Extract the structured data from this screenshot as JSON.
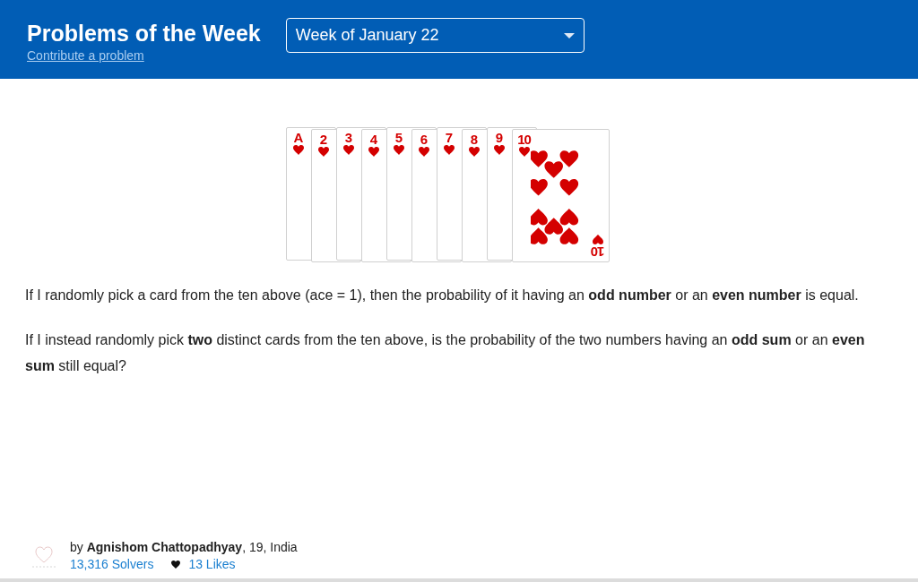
{
  "header": {
    "title": "Problems of the Week",
    "link": "Contribute a problem",
    "week_select": {
      "value": "Week of January 22"
    }
  },
  "cards": [
    {
      "rank": "A",
      "kind": "covered"
    },
    {
      "rank": "2",
      "kind": "covered"
    },
    {
      "rank": "3",
      "kind": "covered"
    },
    {
      "rank": "4",
      "kind": "covered"
    },
    {
      "rank": "5",
      "kind": "covered"
    },
    {
      "rank": "6",
      "kind": "covered"
    },
    {
      "rank": "7",
      "kind": "covered"
    },
    {
      "rank": "8",
      "kind": "covered"
    },
    {
      "rank": "9",
      "kind": "covered"
    },
    {
      "rank": "10",
      "kind": "full",
      "bottom_rank": "10"
    }
  ],
  "paragraphs": [
    "If I randomly pick a card from the ten above (ace = 1), then the probability of it having an **odd number** or an **even number** is equal.",
    "If I instead randomly pick **two** distinct cards from the ten above, is the probability of the two numbers having an **odd sum** or an **even sum** still equal?"
  ],
  "footer": {
    "by": "by",
    "author": "Agnishom Chattopadhyay",
    "details": ", 19, India",
    "solvers": "13,316 Solvers",
    "likes": "13 Likes"
  }
}
